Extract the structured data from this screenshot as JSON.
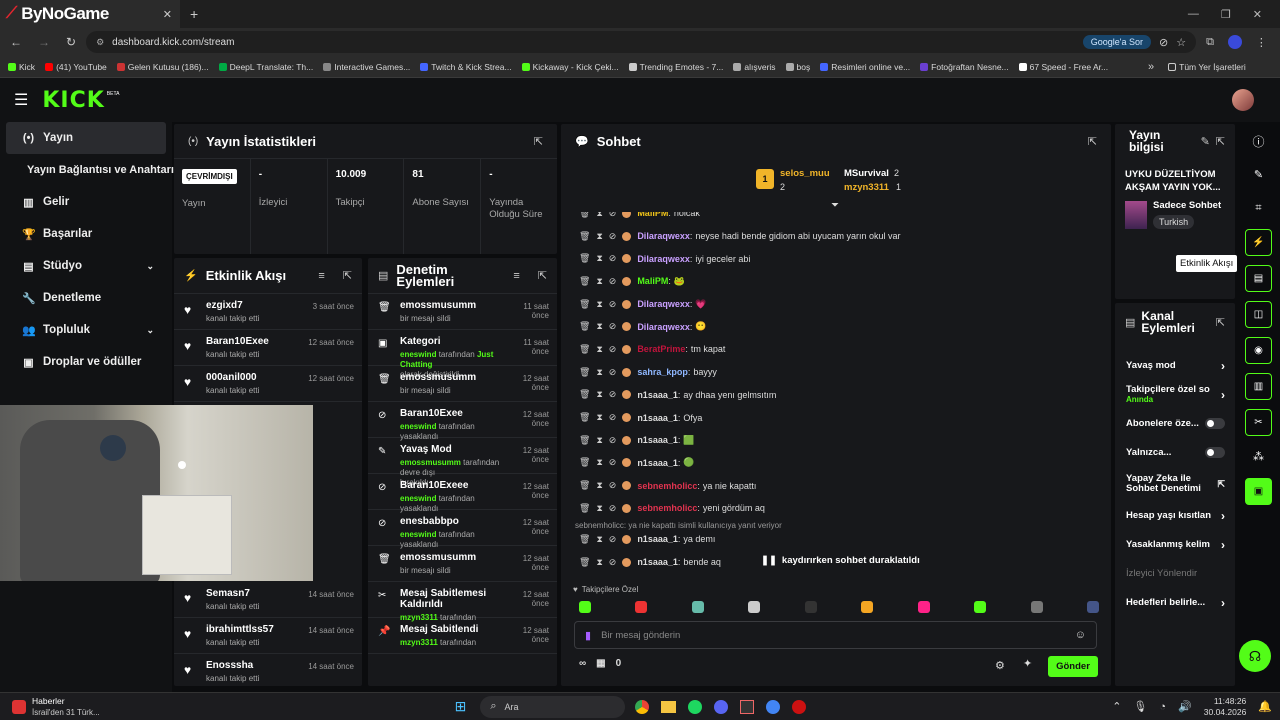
{
  "browser": {
    "tab_title": "ByNoGame",
    "url": "dashboard.kick.com/stream",
    "google_chip": "Google'a Sor",
    "bookmarks": [
      "Kick",
      "(41) YouTube",
      "Gelen Kutusu (186)...",
      "DeepL Translate: Th...",
      "Interactive Games...",
      "Twitch & Kick Strea...",
      "Kickaway - Kick Çeki...",
      "Trending Emotes - 7...",
      "alışveris",
      "boş",
      "Resimleri online ve...",
      "Fotoğraftan Nesne...",
      "67 Speed - Free Ar..."
    ],
    "all_bookmarks": "Tüm Yer İşaretleri"
  },
  "app": {
    "logo": "KICK",
    "logo_badge": "BETA"
  },
  "sidebar": {
    "items": [
      {
        "label": "Yayın",
        "icon": "broadcast-icon"
      },
      {
        "label": "Yayın Bağlantısı ve Anahtarı",
        "icon": ""
      },
      {
        "label": "Gelir",
        "icon": "chart-icon"
      },
      {
        "label": "Başarılar",
        "icon": "trophy-icon"
      },
      {
        "label": "Stüdyo",
        "icon": "studio-icon"
      },
      {
        "label": "Denetleme",
        "icon": "wrench-icon"
      },
      {
        "label": "Topluluk",
        "icon": "people-icon"
      },
      {
        "label": "Droplar ve ödüller",
        "icon": "gift-icon"
      }
    ]
  },
  "stats": {
    "title": "Yayın İstatistikleri",
    "status_badge": "ÇEVRİMDIŞI",
    "items": [
      {
        "value": "",
        "label": "Yayın"
      },
      {
        "value": "-",
        "label": "İzleyici"
      },
      {
        "value": "10.009",
        "label": "Takipçi"
      },
      {
        "value": "81",
        "label": "Abone Sayısı"
      },
      {
        "value": "-",
        "label": "Yayında Olduğu Süre"
      }
    ]
  },
  "activity": {
    "title": "Etkinlik Akışı",
    "rows": [
      {
        "name": "ezgixd7",
        "sub": "kanalı takip etti",
        "time": "3 saat önce"
      },
      {
        "name": "Baran10Exee",
        "sub": "kanalı takip etti",
        "time": "12 saat önce"
      },
      {
        "name": "000anil000",
        "sub": "kanalı takip etti",
        "time": "12 saat önce"
      },
      {
        "name": "Semasn7",
        "sub": "kanalı takip etti",
        "time": "14 saat önce"
      },
      {
        "name": "ibrahimttlss57",
        "sub": "kanalı takip etti",
        "time": "14 saat önce"
      },
      {
        "name": "Enosssha",
        "sub": "kanalı takip etti",
        "time": "14 saat önce"
      }
    ]
  },
  "moderation": {
    "title": "Denetim Eylemleri",
    "rows": [
      {
        "name": "emossmusumm",
        "sub": "bir mesajı sildi",
        "time": "11 saat önce"
      },
      {
        "name": "Kategori",
        "green": "eneswind",
        "mid": "tarafından",
        "green2": "Just Chatting",
        "sub": "olarak değiştirildi",
        "time": "11 saat önce"
      },
      {
        "name": "emossmusumm",
        "sub": "bir mesajı sildi",
        "time": "12 saat önce"
      },
      {
        "name": "Baran10Exee",
        "green": "eneswind",
        "mid": "tarafından yasaklandı",
        "time": "12 saat önce"
      },
      {
        "name": "Yavaş Mod",
        "green": "emossmusumm",
        "mid": "tarafından devre dışı",
        "sub": "bırakıldı",
        "time": "12 saat önce"
      },
      {
        "name": "Baran10Exeee",
        "green": "eneswind",
        "mid": "tarafından yasaklandı",
        "time": "12 saat önce"
      },
      {
        "name": "enesbabbpo",
        "green": "eneswind",
        "mid": "tarafından yasaklandı",
        "time": "12 saat önce"
      },
      {
        "name": "emossmusumm",
        "sub": "bir mesajı sildi",
        "time": "12 saat önce"
      },
      {
        "name": "Mesaj Sabitlemesi Kaldırıldı",
        "green": "mzyn3311",
        "mid": "tarafından",
        "time": "12 saat önce"
      },
      {
        "name": "Mesaj Sabitlendi",
        "green": "mzyn3311",
        "mid": "tarafından",
        "time": "12 saat önce"
      }
    ]
  },
  "chat": {
    "title": "Sohbet",
    "leaderboard": [
      {
        "rank": "1",
        "name": "selos_muu",
        "count": "2"
      },
      {
        "name": "MSurvival",
        "count": "2"
      },
      {
        "name": "mzyn3311",
        "count": "1"
      }
    ],
    "messages": [
      {
        "user": "MaliPM",
        "color": "#f0c419",
        "text": "nolcak"
      },
      {
        "user": "Dilaraqwexx",
        "color": "#c9a0ff",
        "text": "neyse hadi bende gidiom abi uyucam yarın okul var"
      },
      {
        "user": "Dilaraqwexx",
        "color": "#c9a0ff",
        "text": "iyi geceler abi"
      },
      {
        "user": "MaliPM",
        "color": "#53fc18",
        "text": "🐸"
      },
      {
        "user": "Dilaraqwexx",
        "color": "#c9a0ff",
        "text": "💗"
      },
      {
        "user": "Dilaraqwexx",
        "color": "#c9a0ff",
        "text": "😶"
      },
      {
        "user": "BeratPrime",
        "color": "#c0143c",
        "text": "tm kapat"
      },
      {
        "user": "sahra_kpop",
        "color": "#8fb7ff",
        "text": "bayyy"
      },
      {
        "user": "n1saaa_1",
        "color": "#ddd",
        "text": "ay dhaa yenı gelmsıtım"
      },
      {
        "user": "n1saaa_1",
        "color": "#ddd",
        "text": "Ofya"
      },
      {
        "user": "n1saaa_1",
        "color": "#ddd",
        "text": "🟩"
      },
      {
        "user": "n1saaa_1",
        "color": "#ddd",
        "text": "🟢"
      },
      {
        "user": "sebnemholicc",
        "color": "#e0334f",
        "text": "ya nie kapattı"
      },
      {
        "user": "sebnemholicc",
        "color": "#e0334f",
        "text": "yeni gördüm aq"
      }
    ],
    "reply_note": "sebnemholicc: ya nie kapattı isimli kullanıcıya yanıt veriyor",
    "reply_messages": [
      {
        "user": "n1saaa_1",
        "color": "#ddd",
        "text": "ya demı"
      },
      {
        "user": "n1saaa_1",
        "color": "#ddd",
        "text": "bende aq"
      }
    ],
    "paused": "kaydırırken sohbet duraklatıldı",
    "followers_only": "Takipçilere Özel",
    "input_placeholder": "Bir mesaj gönderin",
    "points": "0",
    "send": "Gönder"
  },
  "info": {
    "title": "Yayın bilgisi",
    "stream_title": "UYKU DÜZELTİYOM AKŞAM YAYIN YOK...",
    "category": "Sadece Sohbet",
    "language": "Turkish"
  },
  "channel": {
    "title": "Kanal Eylemleri",
    "items": [
      {
        "label": "Yavaş mod",
        "type": "chevron"
      },
      {
        "label": "Takipçilere özel so",
        "sub": "Anında",
        "type": "chevron"
      },
      {
        "label": "Abonelere öze...",
        "type": "toggle"
      },
      {
        "label": "Yalnızca...",
        "type": "toggle"
      },
      {
        "label": "Yapay Zeka ile Sohbet Denetimi",
        "type": "external"
      },
      {
        "label": "Hesap yaşı kısıtlan",
        "type": "chevron"
      },
      {
        "label": "Yasaklanmış kelim",
        "type": "chevron"
      },
      {
        "label": "İzleyici Yönlendir",
        "type": "disabled"
      },
      {
        "label": "Hedefleri belirle...",
        "type": "chevron"
      }
    ]
  },
  "tooltip": "Etkinlik Akışı",
  "taskbar": {
    "news_title": "Haberler",
    "news_sub": "İsrail'den 31 Türk...",
    "search": "Ara",
    "time": "11:48:26",
    "date": "30.04.2026"
  },
  "colors": {
    "accent": "#53fc18",
    "bg": "#0b0c0e",
    "panel": "#17181b"
  }
}
